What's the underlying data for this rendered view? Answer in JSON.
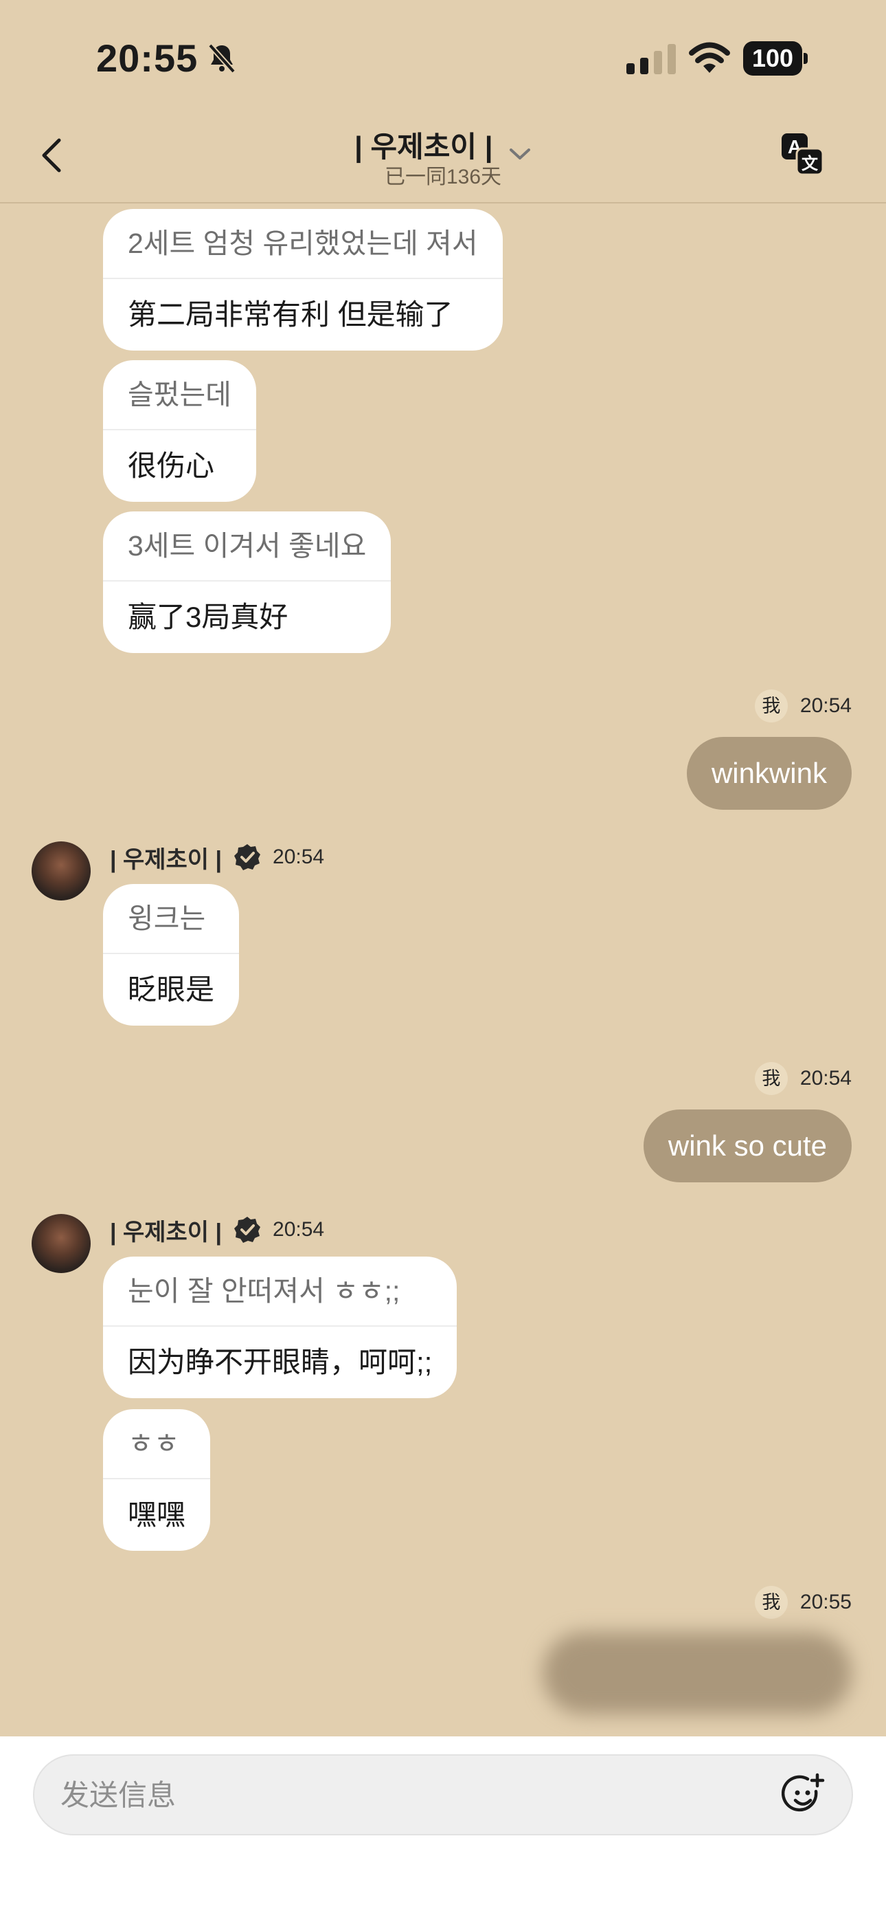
{
  "status_bar": {
    "time": "20:55",
    "battery": "100"
  },
  "header": {
    "title": "| 우제초이 |",
    "subtitle": "已一同136天"
  },
  "messages": {
    "m1": {
      "original": "2세트 엄청 유리했었는데 져서",
      "translated": "第二局非常有利 但是输了"
    },
    "m2": {
      "original": "슬펐는데",
      "translated": "很伤心"
    },
    "m3": {
      "original": "3세트 이겨서 좋네요",
      "translated": "赢了3局真好"
    },
    "me1": {
      "badge": "我",
      "time": "20:54",
      "text": "winkwink"
    },
    "s1": {
      "name": "| 우제초이 |",
      "time": "20:54"
    },
    "m4": {
      "original": "윙크는",
      "translated": "眨眼是"
    },
    "me2": {
      "badge": "我",
      "time": "20:54",
      "text": "wink so cute"
    },
    "s2": {
      "name": "| 우제초이 |",
      "time": "20:54"
    },
    "m5": {
      "original": "눈이 잘 안떠져서 ㅎㅎ;;",
      "translated": "因为睁不开眼睛，呵呵;;"
    },
    "m6": {
      "original": "ㅎㅎ",
      "translated": "嘿嘿"
    },
    "me3": {
      "badge": "我",
      "time": "20:55"
    }
  },
  "composer": {
    "placeholder": "发送信息"
  },
  "icons": {
    "bell": "bell-slash-icon",
    "signal": "cellular-signal-icon",
    "wifi": "wifi-icon",
    "back": "chevron-left-icon",
    "dropdown": "chevron-down-icon",
    "translate": "translate-icon",
    "verified": "verified-badge-icon",
    "emoji": "emoji-add-icon"
  },
  "colors": {
    "background": "#e2cfaf",
    "my_bubble": "#ad9a7d",
    "their_bubble": "#ffffff"
  }
}
